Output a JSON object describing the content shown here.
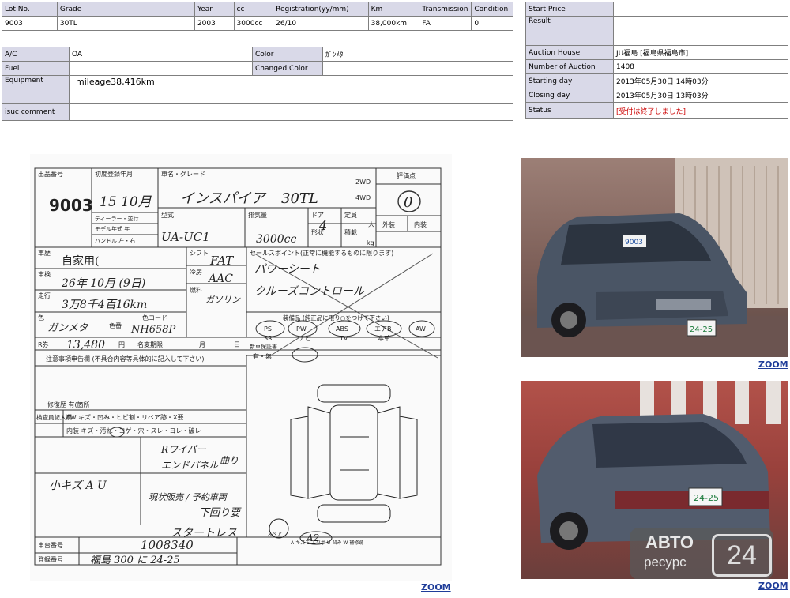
{
  "lot_table": {
    "headers": [
      "Lot No.",
      "Grade",
      "Year",
      "cc",
      "Registration(yy/mm)",
      "Km",
      "Transmission",
      "Condition"
    ],
    "values": [
      "9003",
      "30TL",
      "2003",
      "3000cc",
      "26/10",
      "38,000km",
      "FA",
      "0"
    ]
  },
  "info_table": {
    "ac_label": "A/C",
    "ac_value": "OA",
    "color_label": "Color",
    "color_value": "ｶﾞﾝﾒﾀ",
    "fuel_label": "Fuel",
    "fuel_value": "",
    "changed_color_label": "Changed Color",
    "changed_color_value": "",
    "equipment_label": "Equipment",
    "equipment_value": "mileage38,416km",
    "comment_label": "isuc comment",
    "comment_value": ""
  },
  "auction_table": {
    "start_price_label": "Start Price",
    "start_price_value": "",
    "result_label": "Result",
    "result_value": "",
    "house_label": "Auction House",
    "house_value": "JU福島 [福島県福島市]",
    "number_label": "Number of Auction",
    "number_value": "1408",
    "starting_label": "Starting day",
    "starting_value": "2013年05月30日 14時03分",
    "closing_label": "Closing day",
    "closing_value": "2013年05月30日 13時03分",
    "status_label": "Status",
    "status_value": "[受付は終了しました]"
  },
  "auction_sheet": {
    "lot_label": "出品番号",
    "lot_number": "9003",
    "first_reg_label": "初度登録年月",
    "first_reg": "15 10月",
    "name_grade_label": "車名・グレード",
    "car_name": "インスパイア",
    "grade": "30TL",
    "drive_2wd": "2WD",
    "drive_4wd": "4WD",
    "score_label": "評価点",
    "score": "0",
    "exterior_label": "外装",
    "interior_label": "内装",
    "dealer_label": "ディーラー・並行",
    "model_year_label": "モデル年式 年",
    "handle_label": "ハンドル 左・右",
    "type_label": "型式",
    "type_value": "UA-UC1",
    "displacement_label": "排気量",
    "displacement": "3000cc",
    "doors_label": "ドア",
    "doors": "4",
    "shape_label": "形状",
    "capacity_label": "定員",
    "capacity_unit": "人",
    "load_label": "積載",
    "load_unit": "kg",
    "usage_label": "車歴",
    "usage": "自家用(",
    "shift_label": "シフト",
    "shift": "FAT",
    "inspection_label": "車検",
    "inspection": "26年 10月 (9日)",
    "aircon_label": "冷房",
    "aircon": "AAC",
    "mileage_label": "走行",
    "mileage": "3万8千4百16km",
    "fuel_label": "燃料",
    "fuel": "ガソリン",
    "color_label": "色",
    "color": "ガンメタ",
    "color_no_label": "色番",
    "color_code_label": "色コード",
    "color_code": "NH658P",
    "sale_points_label": "セールスポイント(正常に機能するものに限ります)",
    "sale_point_1": "パワーシート",
    "sale_point_2": "クルーズコントロール",
    "equipment_label": "装備品 (純正品に限り○をつけて下さい)",
    "equipment": [
      "PS",
      "PW",
      "ABS",
      "エアB",
      "AW",
      "SR",
      "ナビ",
      "TV",
      "本革"
    ],
    "recycle_label": "R券",
    "recycle_amount": "13,480",
    "recycle_unit": "円",
    "expiry_label": "名変期限",
    "month_label": "月",
    "day_label": "日",
    "new_warranty_label": "新車保証書",
    "new_warranty_value": "有・無",
    "notes_label": "注意事項申告欄 (不具合内容等具体的に記入して下さい)",
    "repair_label": "修復歴 有(箇所",
    "inspector_label": "検査員記入欄",
    "fw_row": "FW キズ・凹み・ヒビ割・リペア跡・X要",
    "interior_row": "内装 キズ・汚れ・コゲ・穴・スレ・ヨレ・破レ",
    "note_1": "Rワイパー",
    "note_1b": "曲り",
    "note_2": "エンドパネル",
    "note_3": "小キズ A U",
    "note_4": "現状販売 / 予約車両",
    "note_5": "下回り要",
    "note_6": "スタートレス",
    "spare_label": "スペア",
    "a2_label": "A2",
    "chassis_label": "車台番号",
    "chassis_value": "1008340",
    "plate_label": "登録番号",
    "plate_value": "福島 300 に 24-25",
    "legend": "A-キズ E-エクボ U-凹み W-補修跡"
  },
  "photos": {
    "front_plate": "24-25",
    "front_window_number": "9003",
    "rear_plate": "24-25",
    "watermark_brand": "АВТО",
    "watermark_sub": "ресурс",
    "watermark_number": "24"
  },
  "links": {
    "zoom_label": "ZOOM"
  }
}
